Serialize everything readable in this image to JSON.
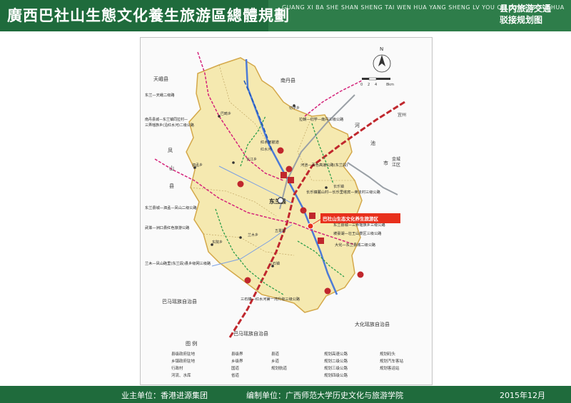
{
  "header": {
    "title": "廣西巴社山生態文化養生旅游區總體規劃",
    "pinyin": "GUANG XI BA SHE SHAN SHENG TAI WEN HUA YANG SHENG LV YOU QU ZONG TI GUI HUA",
    "subtitle_line1": "县内旅游交通",
    "subtitle_line2": "驳接规划图"
  },
  "footer": {
    "owner": "业主单位：香港进源集团",
    "author": "编制单位：广西师范大学历史文化与旅游学院",
    "date": "2015年12月"
  },
  "map": {
    "highlight_label": "巴社山生态文化养生旅游区",
    "compass_letter": "N",
    "scale_labels": [
      "0",
      "2",
      "4",
      "8km"
    ],
    "neighbors": {
      "tianeng": "天峨县",
      "nandan": "南丹县",
      "hechi_a": "河",
      "hechi_b": "池",
      "hechi_c": "市",
      "fengshan_a": "凤",
      "fengshan_b": "山",
      "fengshan_c": "县",
      "bama": "巴马瑶族自治县",
      "bama2": "巴马瑶族自治县",
      "dahua": "大化瑶族自治县",
      "jinchengjiang_a": "金城",
      "jinchengjiang_b": "江区",
      "yizhou": "宜州"
    },
    "towns": {
      "dongnan": "东兰县",
      "changjiang": "长江乡",
      "sanshi": "三石镇",
      "wuzhuan": "五篆镇",
      "simeng": "泗孟乡",
      "changle": "长乐镇",
      "lanmu": "兰木乡",
      "bajiang": "巴畴乡",
      "jinggu": "切学乡",
      "dongyuan": "东院乡",
      "honghe": "红水河"
    },
    "route_labels": [
      "东兰—天峨二级路",
      "南丹县城—东兰镇同拉村—",
      "三弄瑶族乡(沿红水河)二级公路",
      "拉朝—切学—南丹三级公路",
      "红水河航道",
      "河池—百色高速公路(东兰段)",
      "长乐镇麓山村—长乐里塔宾—英法村三级公路",
      "东兰县城—泗孟—凤山二级公路",
      "武篆—洲口县红色旅游公路",
      "东兰县城—三弄瑶族乡三级公路",
      "坡豪湖—壮王山景区三级公路",
      "大化—东兰县城二级公路",
      "兰木—凤山砲里(东兰段)县乡级网三级路",
      "三石镇—红水河第一湾升级三级公路"
    ]
  },
  "legend": {
    "title": "图 例",
    "items": [
      "县级政府驻地",
      "乡镇政府驻地",
      "行政村",
      "河流、水库",
      "县级界",
      "乡级界",
      "国道",
      "省道",
      "县道",
      "乡道",
      "规划航道",
      "规划高速公路",
      "规划二级公路",
      "规划三级公路",
      "规划四级公路",
      "规划码头",
      "规划汽车客站",
      "规划客运站"
    ]
  },
  "colors": {
    "header_bg": "#1f6b3c",
    "map_land": "#f5e9b0",
    "highway": "#c0272d",
    "secondary": "#d4237a",
    "tertiary": "#2a9d4a",
    "river": "#4d7bd6",
    "label_box": "#e8301c"
  }
}
